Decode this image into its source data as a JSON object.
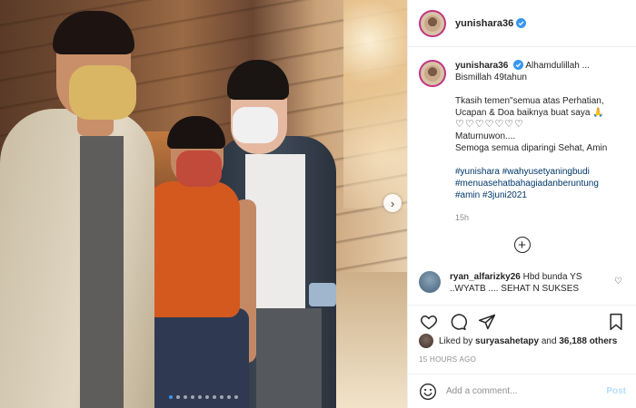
{
  "post": {
    "username": "yunishara36",
    "verified": true
  },
  "caption": {
    "username": "yunishara36",
    "line1": "Alhamdulillah ...",
    "line2": "Bismillah 49tahun",
    "line3": "Tkasih temen\"semua atas Perhatian,",
    "line4": "Ucapan & Doa baiknya buat saya 🙏",
    "hearts": "♡♡♡♡♡♡♡",
    "line5": "Maturnuwon....",
    "line6": "Semoga semua diparingi Sehat, Amin",
    "hashtags": [
      "#yunishara",
      "#wahyusetyaningbudi",
      "#menuasehatbahagiadanberuntung",
      "#amin",
      "#3juni2021"
    ],
    "time": "15h"
  },
  "comment": {
    "username": "ryan_alfarizky26",
    "text": "Hbd bunda YS",
    "text2": "..WYATB .... SEHAT N SUKSES"
  },
  "likes": {
    "prefix": "Liked by",
    "user": "suryasahetapy",
    "connector": "and",
    "count": "36,188 others"
  },
  "posted_ago": "15 HOURS AGO",
  "comment_box": {
    "placeholder": "Add a comment...",
    "post_label": "Post"
  },
  "carousel": {
    "slides": 10,
    "active_index": 0
  },
  "icons": {
    "next": "chevron-right-icon",
    "load_more": "plus-circle-icon",
    "like": "heart-icon",
    "comment": "comment-icon",
    "share": "share-icon",
    "save": "bookmark-icon",
    "emoji": "emoji-icon"
  },
  "colors": {
    "verified": "#3897f0",
    "hashtag": "#00376b",
    "post_disabled": "#b2dffc",
    "muted": "#8e8e8e"
  }
}
